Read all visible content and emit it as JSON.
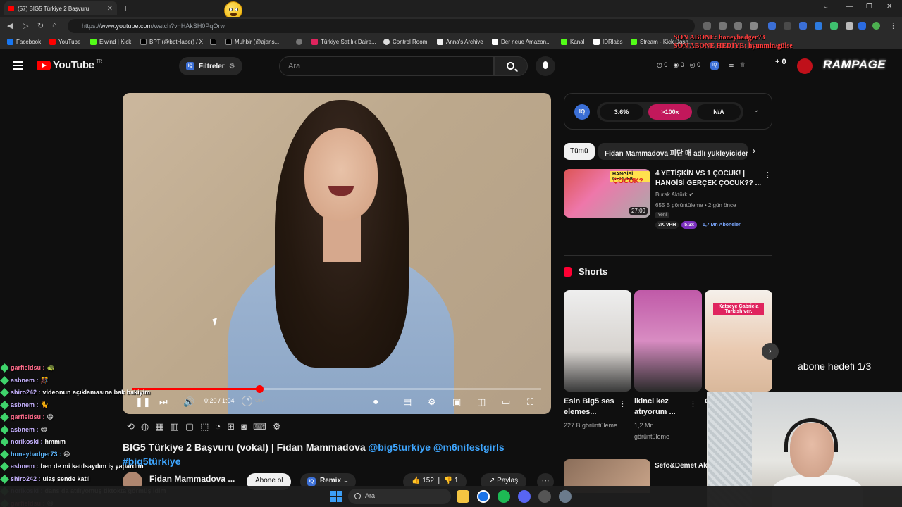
{
  "browser": {
    "tab_title": "(57) BIG5 Türkiye 2 Başvuru",
    "url_prefix": "https://",
    "url_domain": "www.youtube.com",
    "url_path": "/watch?v=HAkSH0PqOrw",
    "bookmarks": [
      "Facebook",
      "YouTube",
      "Elwind | Kick",
      "BPT (@bptHaber) / X",
      "",
      "Muhbir (@ajans...",
      "",
      "Türkiye Satılık Daire...",
      "Control Room",
      "Anna's Archive",
      "Der neue Amazon...",
      "Kanal",
      "IDRlabs",
      "Stream - Kick Dash..."
    ]
  },
  "overlay": {
    "son_abone": "SON ABONE: honeybadger73",
    "son_abone_hediye": "SON ABONE HEDİYE: hyunmin/gülse",
    "rampage": "RAMPAGE",
    "abone_hedefi": "abone hedefi 1/3"
  },
  "youtube": {
    "logo_text": "YouTube",
    "region": "TR",
    "filters_label": "Filtreler",
    "search_placeholder": "Ara",
    "stats": [
      "0",
      "0",
      "0"
    ],
    "create_label": "+ 0",
    "player": {
      "time": "0:20 / 1:04",
      "progress_fraction": 0.31,
      "lr_label": "LR",
      "lr_state": "OFF"
    },
    "title": "BIG5 Türkiye 2 Başvuru (vokal) | Fidan Mammadova",
    "title_tags": [
      "@big5turkiye",
      "@m6nifestgirls"
    ],
    "hashtag": "#big5türkiye",
    "channel_name": "Fidan Mammadova ...",
    "subscribe_label": "Abone ol",
    "remix_label": "Remix",
    "likes": "152",
    "dislikes": "1",
    "share_label": "Paylaş"
  },
  "iq_panel": {
    "badge": "IQ",
    "values": [
      "3.6%",
      ">100x",
      "N/A"
    ]
  },
  "chips": [
    "Tümü",
    "Fidan Mammadova 피단 매 adlı yükleyiciden"
  ],
  "recommended": {
    "thumb_label": "HANGİSİ GERÇEK",
    "thumb_label2": "ÇOCUK?",
    "duration": "27:09",
    "title": "4 YETİŞKİN VS 1 ÇOCUK! | HANGİSİ GERÇEK ÇOCUK?? ...",
    "channel": "Burak Aktürk",
    "meta": "655 B görüntüleme • 2 gün önce",
    "new_label": "Yeni",
    "badges": [
      "3K VPH",
      "5.3x",
      "1,7 Mn Aboneler"
    ]
  },
  "shorts": {
    "heading": "Shorts",
    "items": [
      {
        "title": "Esin Big5 ses elemes...",
        "views": "227 B görüntüleme"
      },
      {
        "title": "ikinci kez atıyorum ...",
        "views": "1,2 Mn görüntüleme"
      },
      {
        "title": "C",
        "views": ""
      }
    ],
    "short3_overlay": "Katseye Gabriela Turkish ver."
  },
  "rec2": {
    "title": "Sefo&Demet Akalın Dur(slowed+reverb)"
  },
  "chat": [
    {
      "user": "garfieldsu",
      "msg": "🐢",
      "color": "#ff6b8a"
    },
    {
      "user": "asbnem",
      "msg": "🎊",
      "color": "#c7b3ff"
    },
    {
      "user": "shiro242",
      "msg": "videonun açıklamasına bak bakiyim",
      "color": "#c7b3ff"
    },
    {
      "user": "asbnem",
      "msg": "🐈",
      "color": "#c7b3ff"
    },
    {
      "user": "garfieldsu",
      "msg": "😄",
      "color": "#ff6b8a"
    },
    {
      "user": "asbnem",
      "msg": "😄",
      "color": "#c7b3ff"
    },
    {
      "user": "norikoski",
      "msg": "hmmm",
      "color": "#c7b3ff"
    },
    {
      "user": "honeybadger73",
      "msg": "😄",
      "color": "#5fb8ff"
    },
    {
      "user": "asbnem",
      "msg": "ben de mi katılsaydım iş yapardım",
      "color": "#c7b3ff"
    },
    {
      "user": "shiro242",
      "msg": "ulaş sende katıl",
      "color": "#c7b3ff"
    },
    {
      "user": "norikoski",
      "msg": "dans da atılıyomuş tiktokta görmüş idim",
      "color": "#c7b3ff"
    },
    {
      "user": "garfieldsu",
      "msg": "😄",
      "color": "#ff6b8a"
    }
  ],
  "taskbar": {
    "search_placeholder": "Ara"
  }
}
